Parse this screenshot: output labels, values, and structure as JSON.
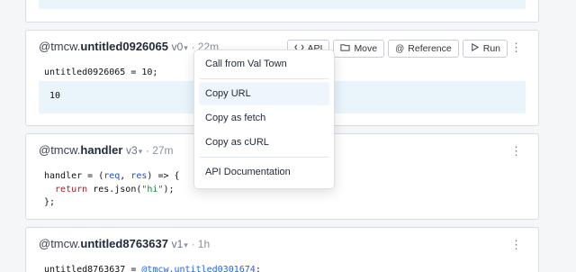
{
  "cards": [
    {
      "user": "@tmcw.",
      "name": "untitled0926065",
      "version": "v0",
      "time": "· 22m",
      "code": [
        "untitled0926065 = 10;"
      ],
      "output": "10",
      "buttons": {
        "api": "API",
        "move": "Move",
        "reference": "Reference",
        "run": "Run"
      }
    },
    {
      "user": "@tmcw.",
      "name": "handler",
      "version": "v3",
      "time": "· 27m",
      "code_parts": {
        "l1a": "handler = (",
        "l1b": "req",
        "l1c": ", ",
        "l1d": "res",
        "l1e": ") => {",
        "l2a": "  return ",
        "l2b": "res.json(",
        "l2c": "\"hi\"",
        "l2d": ");",
        "l3": "};"
      }
    },
    {
      "user": "@tmcw.",
      "name": "untitled8763637",
      "version": "v1",
      "time": "· 1h",
      "code_a": "untitled8763637 = ",
      "code_b": "@tmcw.untitled0301674",
      "code_c": ";"
    }
  ],
  "menu": {
    "items": [
      "Call from Val Town",
      "Copy URL",
      "Copy as fetch",
      "Copy as cURL",
      "API Documentation"
    ],
    "highlighted": "Copy URL"
  },
  "icons": {
    "kebab": "⋮",
    "chevron": "⌵"
  },
  "colors": {
    "accent": "#2563eb",
    "output_bg": "#e9f4fb",
    "menu_highlight": "#eef5fc"
  }
}
